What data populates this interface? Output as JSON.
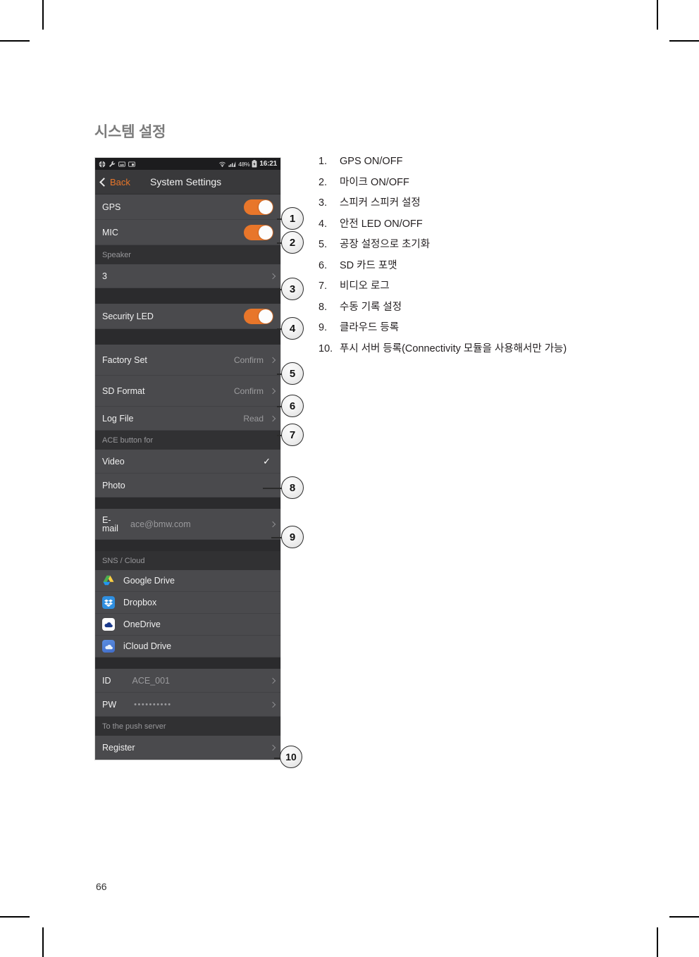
{
  "page": {
    "heading": "시스템 설정",
    "number": "66"
  },
  "phone": {
    "statusbar": {
      "left_icons": [
        "globe-icon",
        "wrench-icon",
        "image-icon",
        "screenshot-icon"
      ],
      "wifi_icon": "wifi-icon",
      "signal_icon": "signal-bars-icon",
      "battery_percent": "48%",
      "battery_icon": "battery-icon",
      "time": "16:21"
    },
    "navbar": {
      "back_label": "Back",
      "title": "System Settings"
    },
    "rows": {
      "gps": {
        "label": "GPS",
        "toggle": "on"
      },
      "mic": {
        "label": "MIC",
        "toggle": "on"
      },
      "speaker_header": "Speaker",
      "speaker_value": "3",
      "security_led": {
        "label": "Security LED",
        "toggle": "on"
      },
      "factory_set": {
        "label": "Factory Set",
        "value": "Confirm"
      },
      "sd_format": {
        "label": "SD Format",
        "value": "Confirm"
      },
      "log_file": {
        "label": "Log File",
        "value": "Read"
      },
      "ace_button_header": "ACE button for",
      "video": {
        "label": "Video",
        "checked": true
      },
      "photo": {
        "label": "Photo",
        "checked": false
      },
      "email": {
        "label": "E-mail",
        "value": "ace@bmw.com"
      },
      "sns_cloud_header": "SNS / Cloud",
      "clouds": [
        {
          "name": "Google Drive",
          "icon": "google-drive-icon"
        },
        {
          "name": "Dropbox",
          "icon": "dropbox-icon"
        },
        {
          "name": "OneDrive",
          "icon": "onedrive-icon"
        },
        {
          "name": "iCloud Drive",
          "icon": "icloud-drive-icon"
        }
      ],
      "id": {
        "label": "ID",
        "value": "ACE_001"
      },
      "pw": {
        "label": "PW",
        "value": "••••••••••"
      },
      "push_server_header": "To the push server",
      "register": {
        "label": "Register"
      }
    }
  },
  "badges": [
    "1",
    "2",
    "3",
    "4",
    "5",
    "6",
    "7",
    "8",
    "9",
    "10"
  ],
  "list": [
    {
      "num": "1.",
      "text": "GPS ON/OFF"
    },
    {
      "num": "2.",
      "text": "마이크 ON/OFF"
    },
    {
      "num": "3.",
      "text": "스피커 스피커 설정"
    },
    {
      "num": "4.",
      "text": "안전 LED ON/OFF"
    },
    {
      "num": "5.",
      "text": "공장 설정으로 초기화"
    },
    {
      "num": "6.",
      "text": "SD 카드 포맷"
    },
    {
      "num": "7.",
      "text": "비디오 로그"
    },
    {
      "num": "8.",
      "text": "수동 기록 설정"
    },
    {
      "num": "9.",
      "text": "클라우드 등록"
    },
    {
      "num": "10.",
      "text": "푸시 서버 등록(Connectivity 모듈을 사용해서만 가능)"
    }
  ],
  "colors": {
    "accent_orange": "#e8762a",
    "row_bg": "#4a4a4d",
    "section_bg": "#313133",
    "statusbar_bg": "#1c1c1e",
    "heading_gray": "#7b7b7b"
  }
}
